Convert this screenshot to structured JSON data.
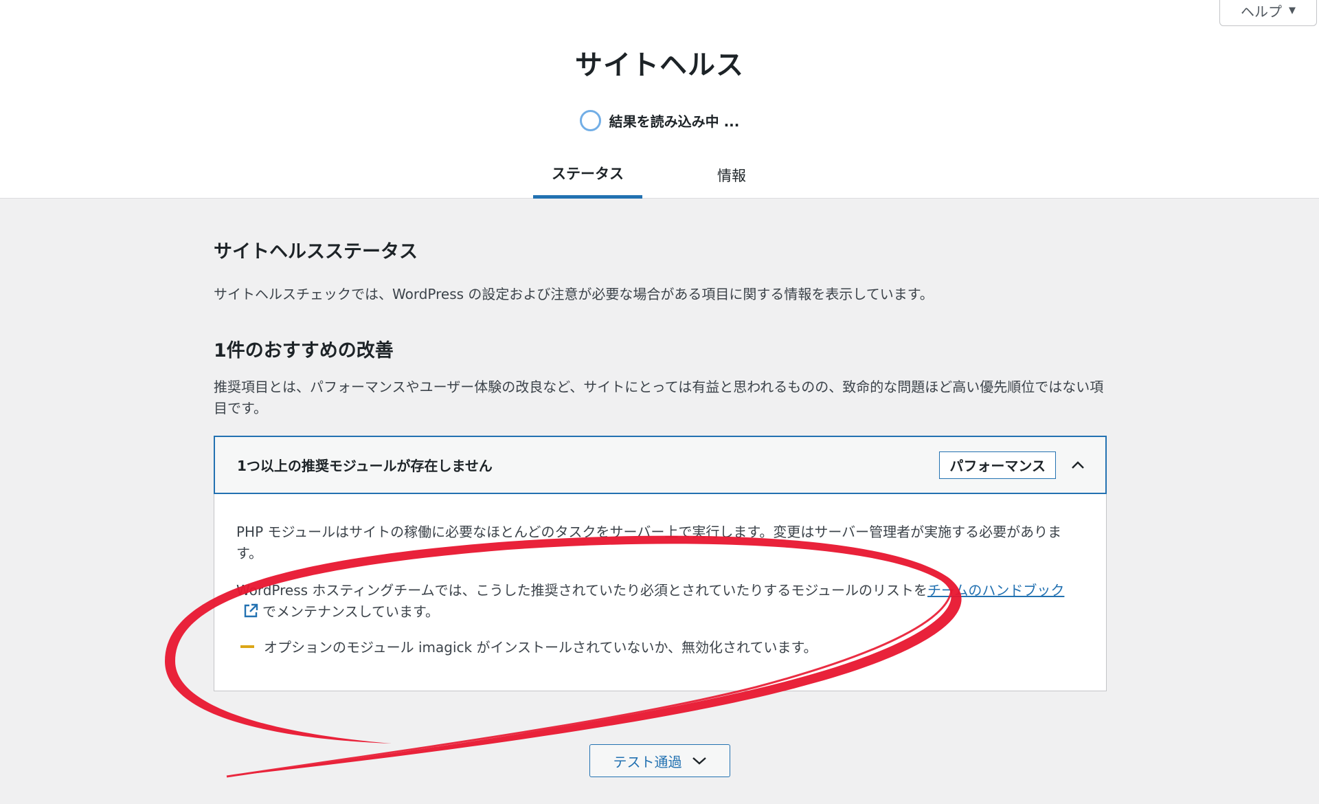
{
  "help": {
    "label": "ヘルプ"
  },
  "page": {
    "title": "サイトヘルス"
  },
  "loading": {
    "text": "結果を読み込み中 ..."
  },
  "tabs": [
    {
      "label": "ステータス",
      "active": true
    },
    {
      "label": "情報",
      "active": false
    }
  ],
  "status_section": {
    "title": "サイトヘルスステータス",
    "description": "サイトヘルスチェックでは、WordPress の設定および注意が必要な場合がある項目に関する情報を表示しています。"
  },
  "recommended": {
    "title": "1件のおすすめの改善",
    "description": "推奨項目とは、パフォーマンスやユーザー体験の改良など、サイトにとっては有益と思われるものの、致命的な問題ほど高い優先順位ではない項目です。"
  },
  "accordion": {
    "title": "1つ以上の推奨モジュールが存在しません",
    "badge": "パフォーマンス",
    "paragraph1": "PHP モジュールはサイトの稼働に必要なほとんどのタスクをサーバー上で実行します。変更はサーバー管理者が実施する必要があります。",
    "paragraph2_before": "WordPress ホスティングチームでは、こうした推奨されていたり必須とされていたりするモジュールのリストを",
    "paragraph2_link": "チームのハンドブック",
    "paragraph2_after": "でメンテナンスしています。",
    "warning": "オプションのモジュール imagick がインストールされていないか、無効化されています。"
  },
  "passed_button": {
    "label": "テスト通過"
  },
  "colors": {
    "accent": "#2271b1",
    "warning": "#dba617",
    "annotation": "#e8162f"
  }
}
